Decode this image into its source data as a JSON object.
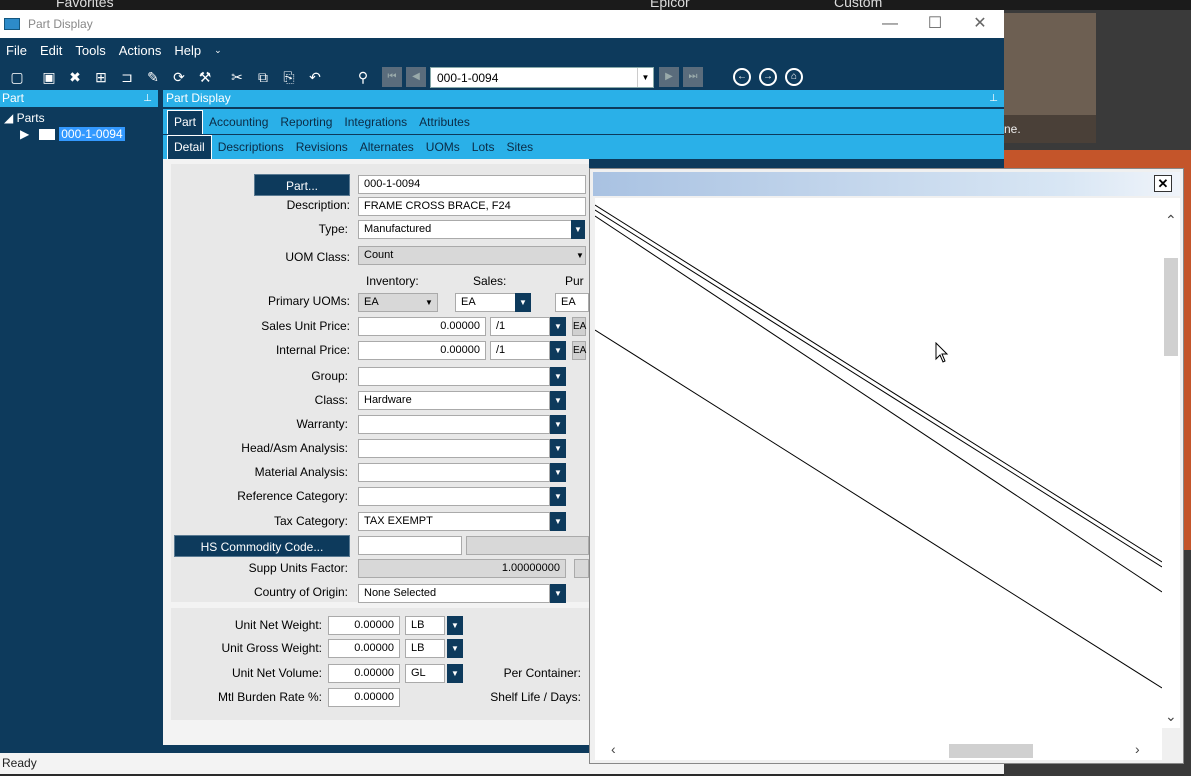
{
  "desktop": {
    "labels": [
      "Favorites",
      "Epicor",
      "Custom"
    ],
    "tile_text": "ne."
  },
  "window": {
    "title": "Part Display",
    "controls": {
      "minimize": "—",
      "maximize": "☐",
      "close": "✕"
    }
  },
  "menu": [
    "File",
    "Edit",
    "Tools",
    "Actions",
    "Help"
  ],
  "toolbar": {
    "key_value": "000-1-0094"
  },
  "tree": {
    "header": "Part",
    "root": "Parts",
    "child": "000-1-0094"
  },
  "form_header": "Part Display",
  "tabs_primary": [
    "Part",
    "Accounting",
    "Reporting",
    "Integrations",
    "Attributes"
  ],
  "tabs_secondary": [
    "Detail",
    "Descriptions",
    "Revisions",
    "Alternates",
    "UOMs",
    "Lots",
    "Sites"
  ],
  "form": {
    "part_button": "Part...",
    "part_value": "000-1-0094",
    "description_label": "Description:",
    "description_value": "FRAME CROSS BRACE, F24",
    "type_label": "Type:",
    "type_value": "Manufactured",
    "uom_class_label": "UOM Class:",
    "uom_class_value": "Count",
    "inventory_header": "Inventory:",
    "sales_header": "Sales:",
    "purchasing_header": "Pur",
    "primary_uoms_label": "Primary UOMs:",
    "inventory_uom": "EA",
    "sales_uom": "EA",
    "purchasing_uom": "EA",
    "sales_unit_price_label": "Sales Unit Price:",
    "sales_unit_price": "0.00000",
    "sales_price_per": "/1",
    "internal_price_label": "Internal Price:",
    "internal_price": "0.00000",
    "internal_price_per": "/1",
    "price_uom_stub": "EA",
    "group_label": "Group:",
    "group_value": "",
    "class_label": "Class:",
    "class_value": "Hardware",
    "warranty_label": "Warranty:",
    "warranty_value": "",
    "head_asm_label": "Head/Asm Analysis:",
    "head_asm_value": "",
    "material_analysis_label": "Material Analysis:",
    "material_analysis_value": "",
    "reference_category_label": "Reference Category:",
    "reference_category_value": "",
    "tax_category_label": "Tax Category:",
    "tax_category_value": "TAX EXEMPT",
    "hs_button": "HS Commodity Code...",
    "supp_units_label": "Supp Units Factor:",
    "supp_units_value": "1.00000000",
    "country_label": "Country of Origin:",
    "country_value": "None Selected",
    "unit_net_weight_label": "Unit Net Weight:",
    "unit_net_weight": "0.00000",
    "unit_net_weight_uom": "LB",
    "unit_gross_weight_label": "Unit Gross Weight:",
    "unit_gross_weight": "0.00000",
    "unit_gross_weight_uom": "LB",
    "unit_net_volume_label": "Unit Net Volume:",
    "unit_net_volume": "0.00000",
    "unit_net_volume_uom": "GL",
    "per_container_label": "Per Container:",
    "mtl_burden_label": "Mtl Burden Rate %:",
    "mtl_burden_value": "0.00000",
    "shelf_life_label": "Shelf Life / Days:"
  },
  "status": "Ready",
  "popup": {
    "close": "✕"
  },
  "colors": {
    "navy": "#0d3a5c",
    "accent_blue": "#2ab0e8",
    "selection": "#3399ff"
  }
}
